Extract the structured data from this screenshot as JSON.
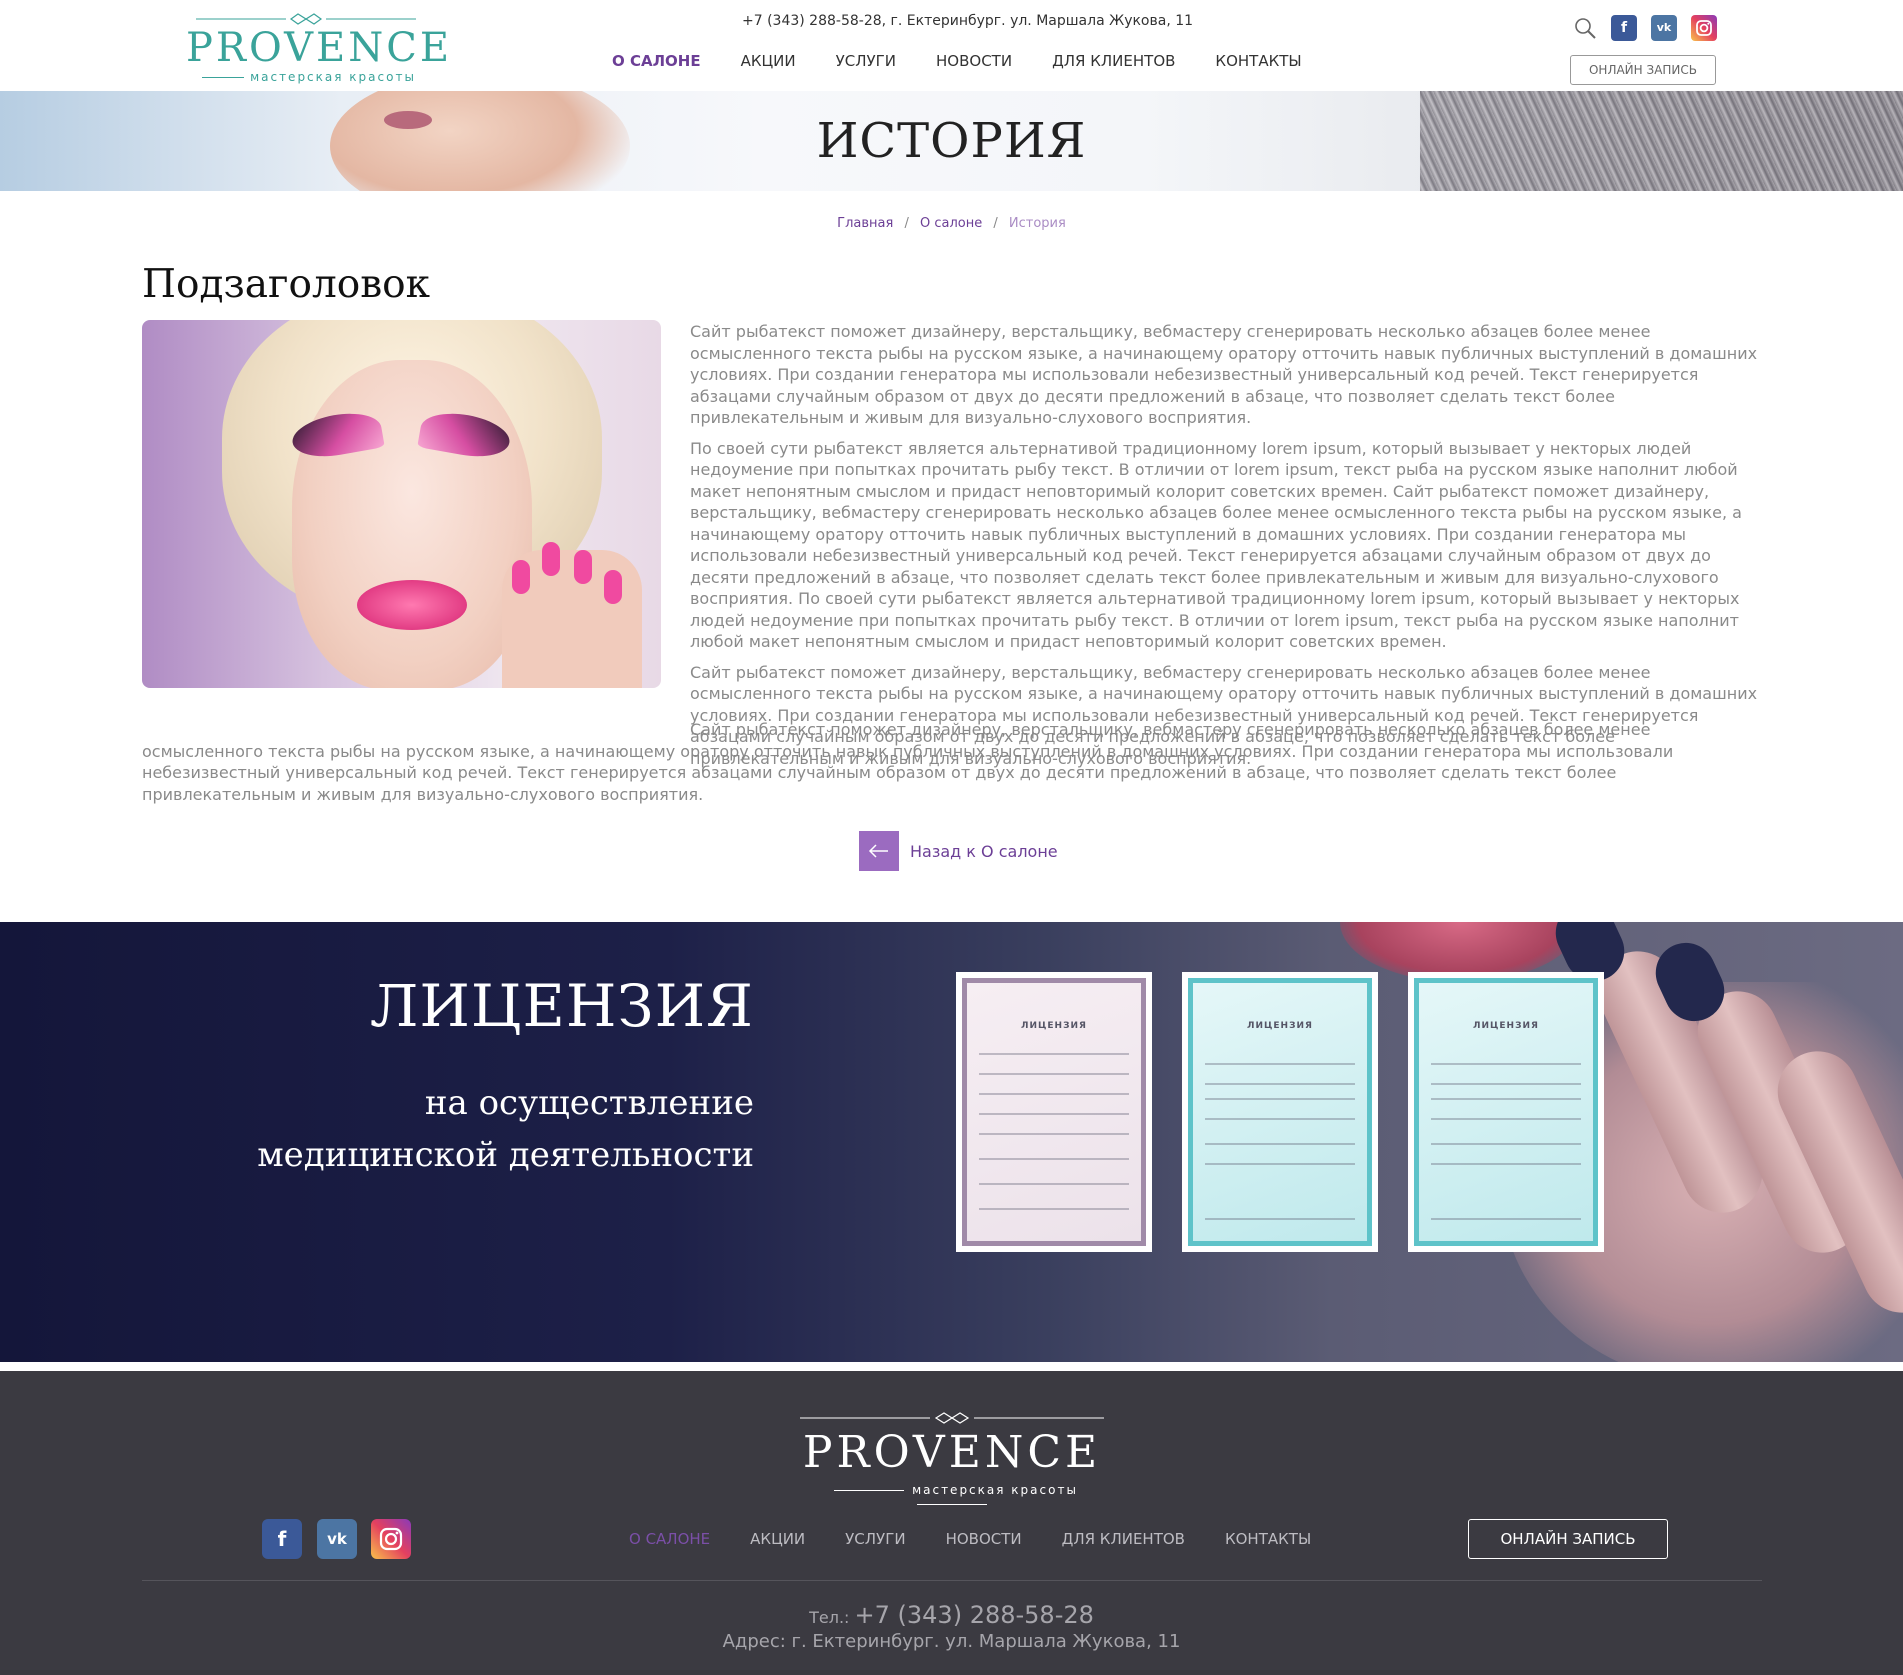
{
  "header": {
    "logo": {
      "brand": "PROVENCE",
      "tagline": "мастерская красоты"
    },
    "contact": "+7 (343) 288-58-28, г. Ектеринбург. ул. Маршала Жукова, 11",
    "nav": [
      {
        "label": "О САЛОНЕ",
        "active": true
      },
      {
        "label": "АКЦИИ"
      },
      {
        "label": "УСЛУГИ"
      },
      {
        "label": "НОВОСТИ"
      },
      {
        "label": "ДЛЯ КЛИЕНТОВ"
      },
      {
        "label": "КОНТАКТЫ"
      }
    ],
    "social": {
      "facebook": "f",
      "vk": "vk"
    },
    "cta": "ОНЛАЙН ЗАПИСЬ"
  },
  "hero": {
    "title": "ИСТОРИЯ"
  },
  "breadcrumb": {
    "home": "Главная",
    "section": "О салоне",
    "current": "История",
    "separator": "/"
  },
  "content": {
    "subtitle": "Подзаголовок",
    "paragraphs": [
      "Сайт рыбатекст поможет дизайнеру, верстальщику, вебмастеру сгенерировать несколько абзацев более менее осмысленного текста рыбы на русском языке, а начинающему оратору отточить навык публичных выступлений в домашних условиях. При создании генератора мы использовали небезизвестный универсальный код речей. Текст генерируется абзацами случайным образом от двух до десяти предложений в абзаце, что позволяет сделать текст более привлекательным и живым для визуально-слухового восприятия.",
      "По своей сути рыбатекст является альтернативой традиционному lorem ipsum, который вызывает у некторых людей недоумение при попытках прочитать рыбу текст. В отличии от lorem ipsum, текст рыба на русском языке наполнит любой макет непонятным смыслом и придаст неповторимый колорит советских времен. Сайт рыбатекст поможет дизайнеру, верстальщику, вебмастеру сгенерировать несколько абзацев более менее осмысленного текста рыбы на русском языке, а начинающему оратору отточить навык публичных выступлений в домашних условиях. При создании генератора мы использовали небезизвестный универсальный код речей. Текст генерируется абзацами случайным образом от двух до десяти предложений в абзаце, что позволяет сделать текст более привлекательным и живым для визуально-слухового восприятия. По своей сути рыбатекст является альтернативой традиционному lorem ipsum, который вызывает у некторых людей недоумение при попытках прочитать рыбу текст. В отличии от lorem ipsum, текст рыба на русском языке наполнит любой макет непонятным смыслом и придаст неповторимый колорит советских времен.",
      "Сайт рыбатекст поможет дизайнеру, верстальщику, вебмастеру сгенерировать несколько абзацев более менее осмысленного текста рыбы на русском языке, а начинающему оратору отточить навык публичных выступлений в домашних условиях. При создании генератора мы использовали небезизвестный универсальный код речей. Текст генерируется абзацами случайным образом от двух до десяти предложений в абзаце, что позволяет сделать текст более привлекательным и живым для визуально-слухового восприятия.",
      "Сайт рыбатекст поможет дизайнеру, верстальщику, вебмастеру сгенерировать несколько абзацев более менее осмысленного текста рыбы на русском языке, а начинающему оратору отточить навык публичных выступлений в домашних условиях. При создании генератора мы использовали небезизвестный универсальный код речей. Текст генерируется абзацами случайным образом от двух до десяти предложений в абзаце, что позволяет сделать текст более привлекательным и живым для визуально-слухового восприятия."
    ],
    "back_link": "Назад к О салоне"
  },
  "license": {
    "title": "ЛИЦЕНЗИЯ",
    "subtitle_line1": "на осуществление",
    "subtitle_line2": "медицинской деятельности",
    "document_label": "ЛИЦЕНЗИЯ"
  },
  "footer": {
    "logo": {
      "brand": "PROVENCE",
      "tagline": "мастерская красоты"
    },
    "social": {
      "facebook": "f",
      "vk": "vk"
    },
    "nav": [
      {
        "label": "О САЛОНЕ",
        "active": true
      },
      {
        "label": "АКЦИИ"
      },
      {
        "label": "УСЛУГИ"
      },
      {
        "label": "НОВОСТИ"
      },
      {
        "label": "ДЛЯ КЛИЕНТОВ"
      },
      {
        "label": "КОНТАКТЫ"
      }
    ],
    "cta": "ОНЛАЙН ЗАПИСЬ",
    "phone_label": "Тел.:",
    "phone": "+7 (343) 288-58-28",
    "address": "Адрес: г. Ектеринбург. ул. Маршала Жукова, 11"
  },
  "colors": {
    "accent": "#6c3f96",
    "brand_teal": "#3aa39a",
    "footer_bg": "#3b3a41",
    "license_bg": "#1d2048"
  },
  "icons": [
    "search-icon",
    "facebook-icon",
    "vk-icon",
    "instagram-icon",
    "arrow-left-icon"
  ]
}
